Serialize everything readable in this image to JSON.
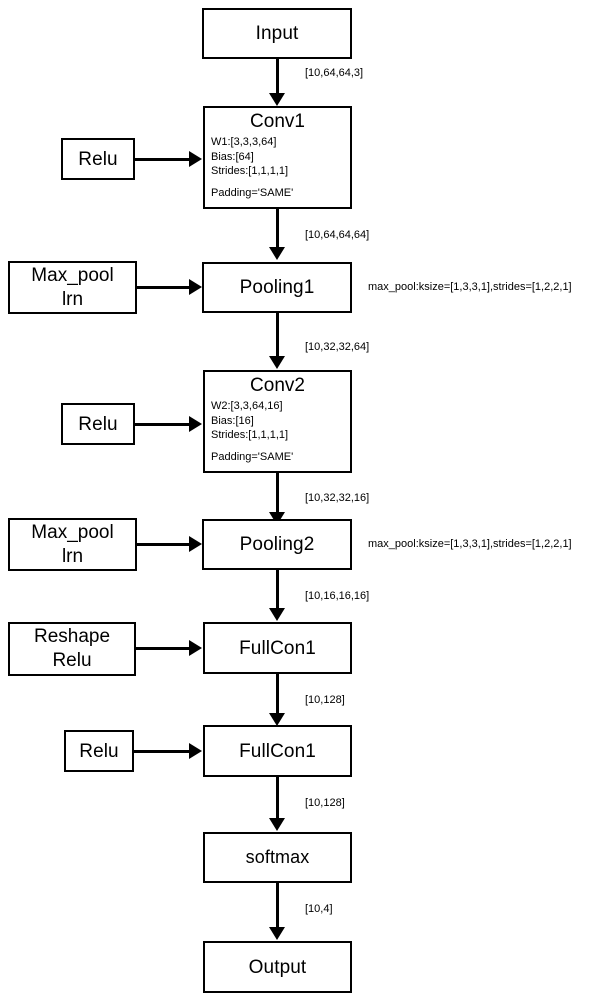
{
  "diagram": {
    "title": "CNN architecture flowchart",
    "nodes": {
      "input": {
        "label": "Input"
      },
      "conv1": {
        "title": "Conv1",
        "weights": "W1:[3,3,3,64]",
        "bias": "Bias:[64]",
        "strides": "Strides:[1,1,1,1]",
        "padding": "Padding='SAME'"
      },
      "relu1": {
        "label": "Relu"
      },
      "pooling1": {
        "label": "Pooling1"
      },
      "maxpool1": {
        "line1": "Max_pool",
        "line2": "lrn"
      },
      "conv2": {
        "title": "Conv2",
        "weights": "W2:[3,3,64,16]",
        "bias": "Bias:[16]",
        "strides": "Strides:[1,1,1,1]",
        "padding": "Padding='SAME'"
      },
      "relu2": {
        "label": "Relu"
      },
      "pooling2": {
        "label": "Pooling2"
      },
      "maxpool2": {
        "line1": "Max_pool",
        "line2": "lrn"
      },
      "fullcon1": {
        "label": "FullCon1"
      },
      "reshape_relu": {
        "line1": "Reshape",
        "line2": "Relu"
      },
      "fullcon2": {
        "label": "FullCon1"
      },
      "relu3": {
        "label": "Relu"
      },
      "softmax": {
        "label": "softmax"
      },
      "output": {
        "label": "Output"
      }
    },
    "edge_labels": {
      "input_conv1": "[10,64,64,3]",
      "conv1_pooling1": "[10,64,64,64]",
      "pooling1_conv2": "[10,32,32,64]",
      "conv2_pooling2": "[10,32,32,16]",
      "pooling2_fullcon1": "[10,16,16,16]",
      "fullcon1_fullcon2": "[10,128]",
      "fullcon2_softmax": "[10,128]",
      "softmax_output": "[10,4]"
    },
    "side_labels": {
      "pooling1_params": "max_pool:ksize=[1,3,3,1],strides=[1,2,2,1]",
      "pooling2_params": "max_pool:ksize=[1,3,3,1],strides=[1,2,2,1]"
    },
    "colors": {
      "stroke": "#000000",
      "fill": "#ffffff",
      "text": "#000000"
    }
  }
}
